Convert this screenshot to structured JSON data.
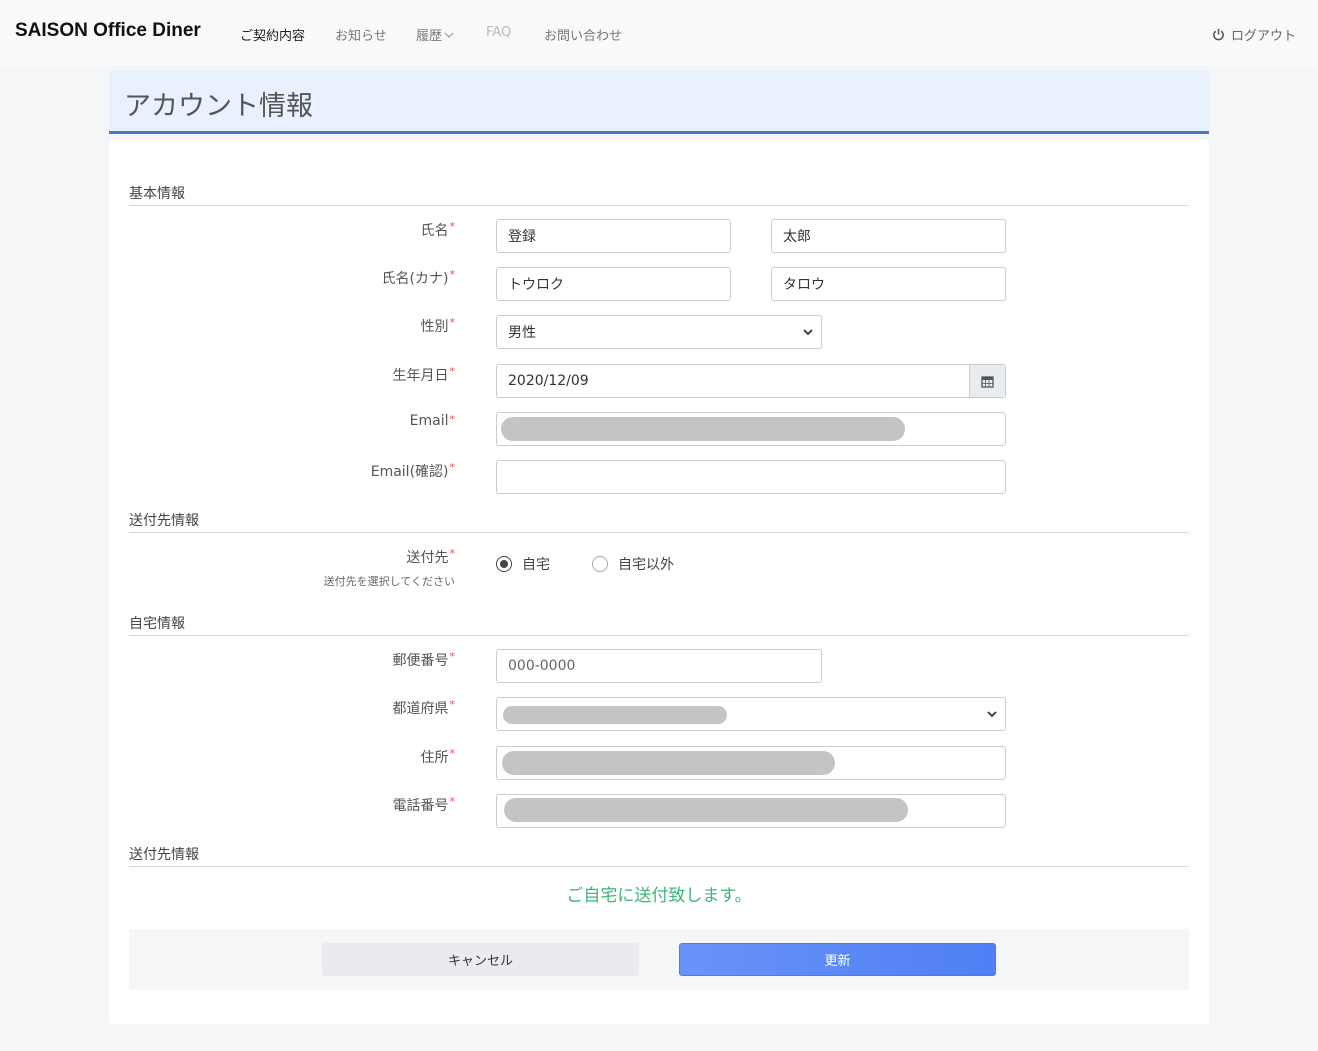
{
  "navbar": {
    "brand": "SAISON Office Diner",
    "items": [
      {
        "label": "ご契約内容"
      },
      {
        "label": "お知らせ"
      },
      {
        "label": "履歴"
      },
      {
        "label": "FAQ"
      },
      {
        "label": "お問い合わせ"
      }
    ],
    "logout": "ログアウト"
  },
  "page": {
    "title": "アカウント情報"
  },
  "sections": {
    "basic": "基本情報",
    "shipping": "送付先情報",
    "home": "自宅情報",
    "shipping2": "送付先情報"
  },
  "form": {
    "required_mark": "*",
    "name": {
      "label": "氏名",
      "last": "登録",
      "first": "太郎"
    },
    "name_kana": {
      "label": "氏名(カナ)",
      "last": "トウロク",
      "first": "タロウ"
    },
    "gender": {
      "label": "性別",
      "value": "男性"
    },
    "birthday": {
      "label": "生年月日",
      "value": "2020/12/09"
    },
    "email": {
      "label": "Email"
    },
    "email_confirm": {
      "label": "Email(確認)",
      "value": ""
    },
    "destination": {
      "label": "送付先",
      "hint": "送付先を選択してください",
      "options": [
        {
          "label": "自宅",
          "selected": true
        },
        {
          "label": "自宅以外",
          "selected": false
        }
      ]
    },
    "postal": {
      "label": "郵便番号",
      "placeholder": "000-0000"
    },
    "prefecture": {
      "label": "都道府県"
    },
    "address": {
      "label": "住所"
    },
    "phone": {
      "label": "電話番号"
    }
  },
  "notice": "ご自宅に送付致します。",
  "buttons": {
    "cancel": "キャンセル",
    "update": "更新"
  },
  "colors": {
    "accent": "#4a78c8",
    "notice": "#3fb57a",
    "primary": "#5b87f6",
    "required": "#e05050"
  }
}
